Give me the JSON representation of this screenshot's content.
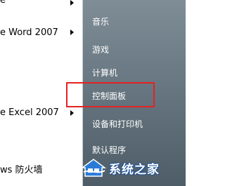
{
  "left_menu": {
    "items": [
      {
        "label": "e"
      },
      {
        "label": "e Word 2007"
      },
      {
        "label": "e Excel 2007"
      },
      {
        "label": "ws 防火墙"
      }
    ]
  },
  "right_menu": {
    "items": [
      {
        "label": "音乐"
      },
      {
        "label": "游戏"
      },
      {
        "label": "计算机"
      },
      {
        "label": "控制面板"
      },
      {
        "label": "设备和打印机"
      },
      {
        "label": "默认程序"
      }
    ]
  },
  "highlight": {
    "target": "控制面板",
    "color": "#e42222"
  },
  "watermark": {
    "text": "系统之家"
  }
}
